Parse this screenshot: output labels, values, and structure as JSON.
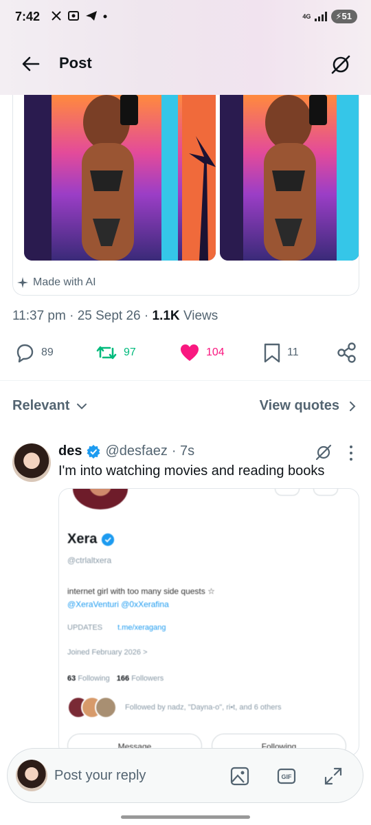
{
  "status_bar": {
    "time": "7:42",
    "network": "4G",
    "battery": "51"
  },
  "header": {
    "title": "Post"
  },
  "post": {
    "made_with_ai": "Made with AI",
    "time": "11:37 pm",
    "date": "25 Sept 26",
    "views_count": "1.1K",
    "views_label": "Views",
    "stats": {
      "replies": "89",
      "reposts": "97",
      "likes": "104",
      "bookmarks": "11"
    }
  },
  "sort": {
    "label": "Relevant",
    "view_quotes": "View quotes"
  },
  "reply": {
    "name": "des",
    "handle": "@desfaez",
    "time": "· 7s",
    "text": "I'm into watching movies and reading books",
    "quoted_profile": {
      "name": "Xera",
      "handle": "@ctrlaltxera",
      "bio": "internet girl with too many side quests ☆",
      "bio_links": "@XeraVenturi @0xXerafina",
      "updates": "UPDATES",
      "link": "t.me/xeragang",
      "joined": "Joined February 2026 >",
      "following_count": "63",
      "following_label": "Following",
      "followers_count": "166",
      "followers_label": "Followers",
      "followed_by": "Followed by nadz, \"Dayna-o\", ri•t, and 6 others",
      "btn_message": "Message",
      "btn_following": "Following"
    }
  },
  "reply_bar": {
    "placeholder": "Post your reply"
  },
  "colors": {
    "accent": "#1d9bf0",
    "repost": "#00ba7c",
    "like": "#f91880",
    "secondary": "#536471"
  }
}
